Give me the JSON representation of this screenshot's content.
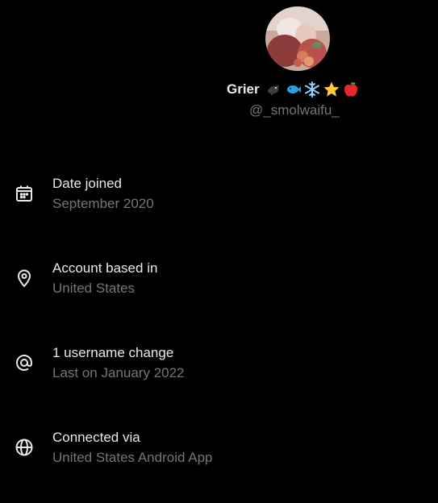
{
  "profile": {
    "display_name": "Grier",
    "name_emojis": [
      "bird-icon",
      "fish-icon",
      "snowflake-icon",
      "star-icon",
      "apple-icon"
    ],
    "handle": "@_smolwaifu_"
  },
  "info_items": [
    {
      "icon": "calendar-icon",
      "label": "Date joined",
      "value": "September 2020"
    },
    {
      "icon": "location-pin-icon",
      "label": "Account based in",
      "value": "United States"
    },
    {
      "icon": "at-sign-icon",
      "label": "1 username change",
      "value": "Last on January 2022"
    },
    {
      "icon": "globe-icon",
      "label": "Connected via",
      "value": "United States Android App"
    }
  ],
  "colors": {
    "background": "#000000",
    "primary_text": "#e7e9ea",
    "secondary_text": "#71767b"
  }
}
